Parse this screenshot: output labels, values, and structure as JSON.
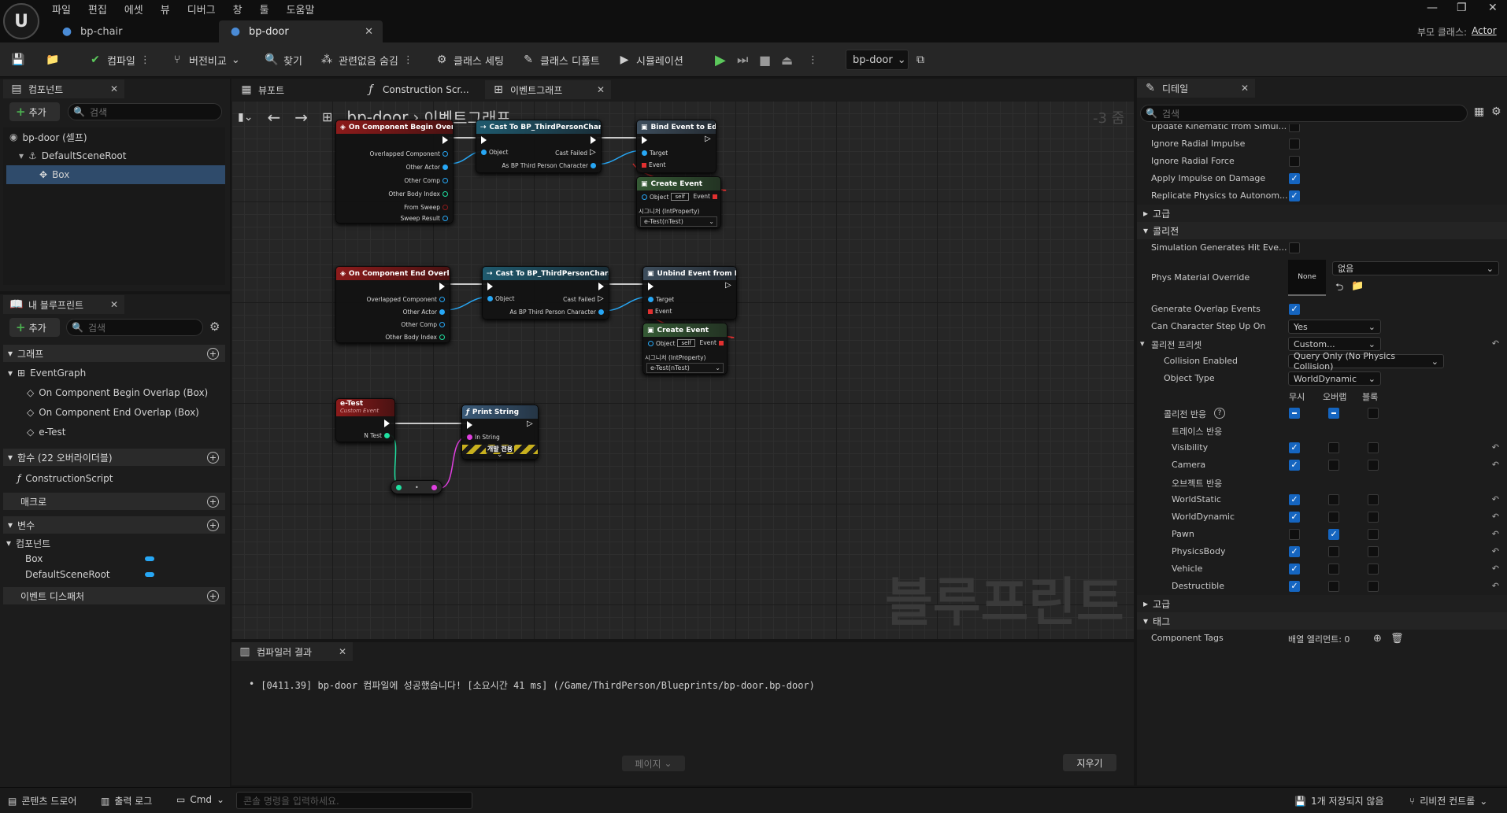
{
  "app": {
    "logo": "U"
  },
  "menu": [
    "파일",
    "편집",
    "에셋",
    "뷰",
    "디버그",
    "창",
    "툴",
    "도움말"
  ],
  "tabs": [
    {
      "label": "bp-chair"
    },
    {
      "label": "bp-door"
    }
  ],
  "parent_class": {
    "label": "부모 클래스:",
    "value": "Actor"
  },
  "toolbar": {
    "compile": "컴파일",
    "diff": "버전비교",
    "find": "찾기",
    "hide_unrelated": "관련없음 숨김",
    "class_settings": "클래스 세팅",
    "class_defaults": "클래스 디폴트",
    "simulation": "시뮬레이션",
    "debug_object": "bp-door"
  },
  "components_panel": {
    "title": "컴포넌트",
    "add": "추가",
    "search_placeholder": "검색",
    "items": [
      "bp-door (셀프)",
      "DefaultSceneRoot",
      "Box"
    ]
  },
  "my_blueprint": {
    "title": "내 블루프린트",
    "add": "추가",
    "search_placeholder": "검색",
    "graph_section": "그래프",
    "event_graph": "EventGraph",
    "events": [
      "On Component Begin Overlap (Box)",
      "On Component End Overlap (Box)",
      "e-Test"
    ],
    "functions_section": "함수 (22 오버라이더블)",
    "construction_script": "ConstructionScript",
    "macros_section": "매크로",
    "variables_section": "변수",
    "components_cat": "컴포넌트",
    "variables": [
      "Box",
      "DefaultSceneRoot"
    ],
    "dispatchers_section": "이벤트 디스패처"
  },
  "center_tabs": {
    "viewport": "뷰포트",
    "construction": "Construction Scr...",
    "event_graph": "이벤트그래프"
  },
  "breadcrumb": {
    "bp": "bp-door",
    "graph": "이벤트그래프",
    "zoom": "-3 줌"
  },
  "watermark": "블루프린트",
  "nodes": {
    "begin_overlap": {
      "title": "On Component Begin Overlap (Box)",
      "pins": [
        "Overlapped Component",
        "Other Actor",
        "Other Comp",
        "Other Body Index",
        "From Sweep",
        "Sweep Result"
      ]
    },
    "cast1": {
      "title": "Cast To BP_ThirdPersonCharacter",
      "object": "Object",
      "failed": "Cast Failed",
      "as": "As BP Third Person Character"
    },
    "bind": {
      "title": "Bind Event to Ed-use",
      "target": "Target",
      "event": "Event"
    },
    "create1": {
      "title": "Create Event",
      "object": "Object",
      "self": "self",
      "event": "Event",
      "sig": "시그니처 (IntProperty)",
      "func": "e-Test(nTest)"
    },
    "end_overlap": {
      "title": "On Component End Overlap (Box)",
      "pins": [
        "Overlapped Component",
        "Other Actor",
        "Other Comp",
        "Other Body Index"
      ]
    },
    "cast2": {
      "title": "Cast To BP_ThirdPersonCharacter",
      "object": "Object",
      "failed": "Cast Failed",
      "as": "As BP Third Person Character"
    },
    "unbind": {
      "title": "Unbind Event from Ed-use",
      "target": "Target",
      "event": "Event"
    },
    "create2": {
      "title": "Create Event",
      "object": "Object",
      "self": "self",
      "event": "Event",
      "sig": "시그니처 (IntProperty)",
      "func": "e-Test(nTest)"
    },
    "etest": {
      "title": "e-Test",
      "subtitle": "Custom Event",
      "pin": "N Test"
    },
    "print": {
      "title": "Print String",
      "in": "In String",
      "dev": "개발 전용"
    }
  },
  "compiler": {
    "title": "컴파일러 결과",
    "message": "[0411.39] bp-door 컴파일에 성공했습니다! [소요시간 41 ms] (/Game/ThirdPerson/Blueprints/bp-door.bp-door)",
    "page": "페이지",
    "clear": "지우기"
  },
  "details": {
    "title": "디테일",
    "search_placeholder": "검색",
    "rows_top": [
      {
        "label": "Update Kinematic from Simul...",
        "checked": false
      },
      {
        "label": "Ignore Radial Impulse",
        "checked": false
      },
      {
        "label": "Ignore Radial Force",
        "checked": false
      },
      {
        "label": "Apply Impulse on Damage",
        "checked": true
      },
      {
        "label": "Replicate Physics to Autonom...",
        "checked": true
      }
    ],
    "advanced": "고급",
    "collision_section": "콜리전",
    "sim_hit": "Simulation Generates Hit Eve...",
    "phys_mat": "Phys Material Override",
    "phys_mat_thumb": "None",
    "phys_mat_value": "없음",
    "gen_overlap": "Generate Overlap Events",
    "step_up": "Can Character Step Up On",
    "step_up_value": "Yes",
    "presets": "콜리전 프리셋",
    "presets_value": "Custom...",
    "collision_enabled": "Collision Enabled",
    "collision_enabled_value": "Query Only (No Physics Collision)",
    "object_type": "Object Type",
    "object_type_value": "WorldDynamic",
    "resp_headers": [
      "무시",
      "오버랩",
      "블록"
    ],
    "collision_response": "콜리전 반응",
    "trace_response": "트레이스 반응",
    "object_response": "오브젝트 반응",
    "responses": [
      {
        "label": "Visibility",
        "state": 0
      },
      {
        "label": "Camera",
        "state": 0
      },
      {
        "label": "WorldStatic",
        "state": 0
      },
      {
        "label": "WorldDynamic",
        "state": 0
      },
      {
        "label": "Pawn",
        "state": 1
      },
      {
        "label": "PhysicsBody",
        "state": 0
      },
      {
        "label": "Vehicle",
        "state": 0
      },
      {
        "label": "Destructible",
        "state": 0
      }
    ],
    "advanced2": "고급",
    "tags_section": "태그",
    "component_tags": "Component Tags",
    "component_tags_value": "배열 엘리먼트: 0"
  },
  "bottom": {
    "content_drawer": "콘텐츠 드로어",
    "output_log": "출력 로그",
    "cmd": "Cmd",
    "cmd_placeholder": "콘솔 명령을 입력하세요.",
    "unsaved": "1개 저장되지 않음",
    "revision": "리비전 컨트롤"
  }
}
